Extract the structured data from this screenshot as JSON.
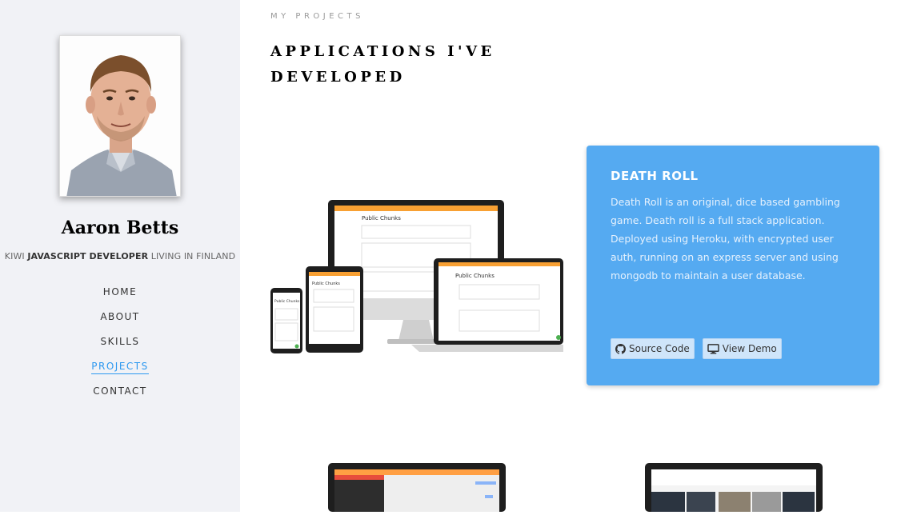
{
  "profile": {
    "name": "Aaron Betts",
    "tagline_pre": "KIWI ",
    "tagline_role": "JAVASCRIPT DEVELOPER",
    "tagline_post": " LIVING IN FINLAND"
  },
  "nav": {
    "items": [
      {
        "label": "HOME"
      },
      {
        "label": "ABOUT"
      },
      {
        "label": "SKILLS"
      },
      {
        "label": "PROJECTS",
        "active": true
      },
      {
        "label": "CONTACT"
      }
    ]
  },
  "section": {
    "kicker": "MY PROJECTS",
    "heading": "APPLICATIONS I'VE DEVELOPED"
  },
  "project": {
    "title": "DEATH ROLL",
    "description": "Death Roll is an original, dice based gambling game. Death roll is a full stack application. Deployed using Heroku, with encrypted user auth, running on an express server and using mongodb to maintain a user database.",
    "source_label": "Source Code",
    "demo_label": "View Demo",
    "source_icon": "github-icon",
    "demo_icon": "monitor-icon"
  },
  "mockup": {
    "app_title": "Public Chunks"
  },
  "colors": {
    "accent": "#2c98f0",
    "card_bg": "#55aaf1",
    "sidebar_bg": "#f1f2f6",
    "app_orange": "#f8a033"
  }
}
